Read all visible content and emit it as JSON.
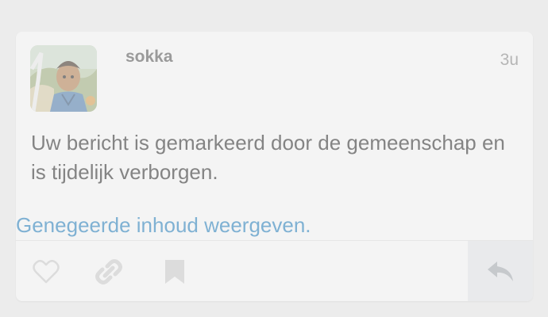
{
  "post": {
    "username": "sokka",
    "time": "3u",
    "message": "Uw bericht is gemarkeerd door de gemeenschap en is tijdelijk verborgen.",
    "show_hidden_link": "Genegeerde inhoud weergeven."
  },
  "actions": {
    "like_icon": "heart-icon",
    "link_icon": "link-icon",
    "bookmark_icon": "bookmark-icon",
    "reply_icon": "reply-icon"
  },
  "colors": {
    "link": "#7fb1d3",
    "text": "#848484",
    "icon": "#dcdcdc"
  }
}
